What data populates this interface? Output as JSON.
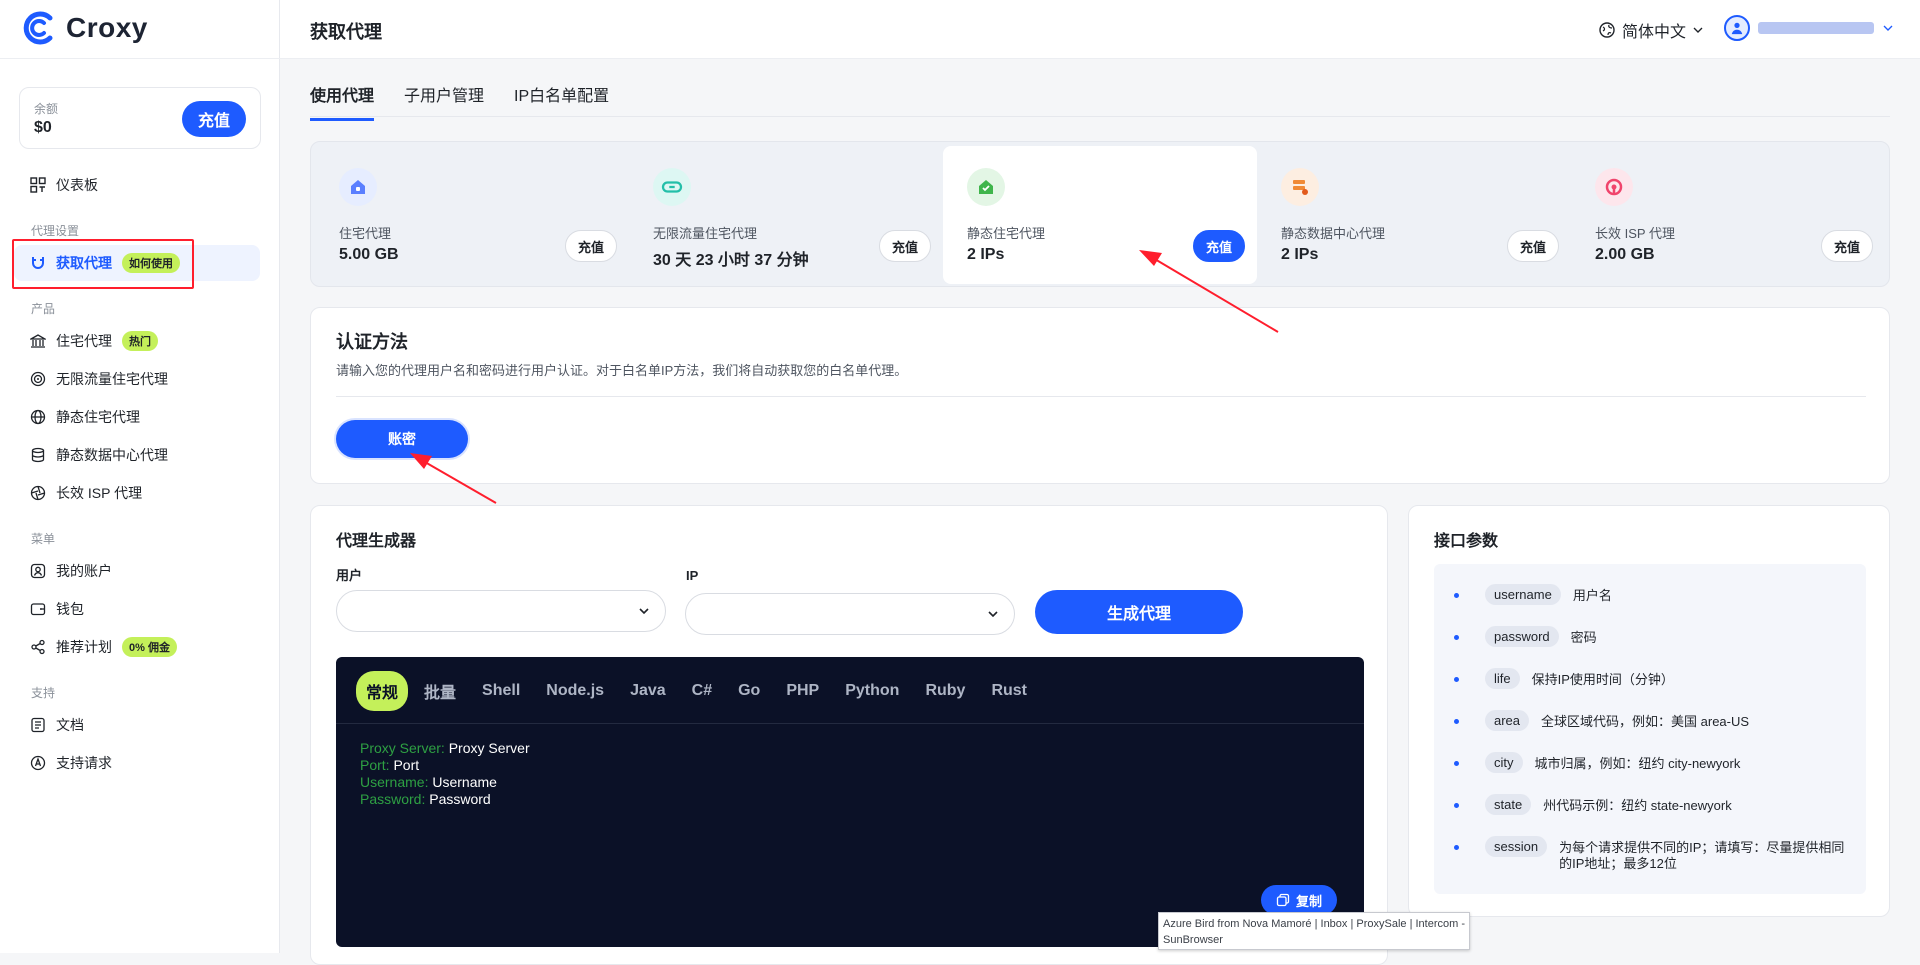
{
  "app": {
    "logo_text": "Croxy"
  },
  "header": {
    "title": "获取代理",
    "language": "简体中文"
  },
  "sidebar": {
    "balance_label": "余额",
    "balance_value": "$0",
    "recharge_label": "充值",
    "dashboard": "仪表板",
    "section_proxy_settings": "代理设置",
    "get_proxy": "获取代理",
    "get_proxy_tag": "如何使用",
    "section_products": "产品",
    "residential": "住宅代理",
    "residential_tag": "热门",
    "unlimited": "无限流量住宅代理",
    "static_residential": "静态住宅代理",
    "static_datacenter": "静态数据中心代理",
    "isp": "长效 ISP 代理",
    "section_menu": "菜单",
    "my_account": "我的账户",
    "wallet": "钱包",
    "referral": "推荐计划",
    "referral_tag": "0% 佣金",
    "section_support": "支持",
    "docs": "文档",
    "support_request": "支持请求"
  },
  "tabs": [
    "使用代理",
    "子用户管理",
    "IP白名单配置"
  ],
  "products": [
    {
      "name": "住宅代理",
      "value": "5.00 GB",
      "button": "充值"
    },
    {
      "name": "无限流量住宅代理",
      "value": "30 天 23 小时 37 分钟",
      "button": "充值"
    },
    {
      "name": "静态住宅代理",
      "value": "2 IPs",
      "button": "充值"
    },
    {
      "name": "静态数据中心代理",
      "value": "2 IPs",
      "button": "充值"
    },
    {
      "name": "长效 ISP 代理",
      "value": "2.00 GB",
      "button": "充值"
    }
  ],
  "auth": {
    "title": "认证方法",
    "description": "请输入您的代理用户名和密码进行用户认证。对于白名单IP方法，我们将自动获取您的白名单代理。",
    "button": "账密"
  },
  "generator": {
    "title": "代理生成器",
    "user_label": "用户",
    "ip_label": "IP",
    "generate_button": "生成代理",
    "code_tabs": [
      "常规",
      "批量",
      "Shell",
      "Node.js",
      "Java",
      "C#",
      "Go",
      "PHP",
      "Python",
      "Ruby",
      "Rust"
    ],
    "lines": [
      {
        "key": "Proxy Server:",
        "value": "Proxy Server"
      },
      {
        "key": "Port:",
        "value": "Port"
      },
      {
        "key": "Username:",
        "value": "Username"
      },
      {
        "key": "Password:",
        "value": "Password"
      }
    ],
    "copy_button": "复制"
  },
  "api": {
    "title": "接口参数",
    "params": [
      {
        "key": "username",
        "desc": "用户名"
      },
      {
        "key": "password",
        "desc": "密码"
      },
      {
        "key": "life",
        "desc": "保持IP使用时间（分钟）"
      },
      {
        "key": "area",
        "desc": "全球区域代码，例如：美国 area-US"
      },
      {
        "key": "city",
        "desc": "城市归属，例如：纽约 city-newyork"
      },
      {
        "key": "state",
        "desc": "州代码示例：纽约 state-newyork"
      },
      {
        "key": "session",
        "desc": "为每个请求提供不同的IP；请填写：尽量提供相同的IP地址；最多12位"
      }
    ]
  },
  "tooltip": "Azure Bird from Nova Mamoré | Inbox | ProxySale | Intercom - SunBrowser",
  "colors": {
    "accent": "#1e5bff",
    "highlight": "#c4f05a",
    "annotation": "#ff1e2d",
    "code_bg": "#0b1127"
  }
}
